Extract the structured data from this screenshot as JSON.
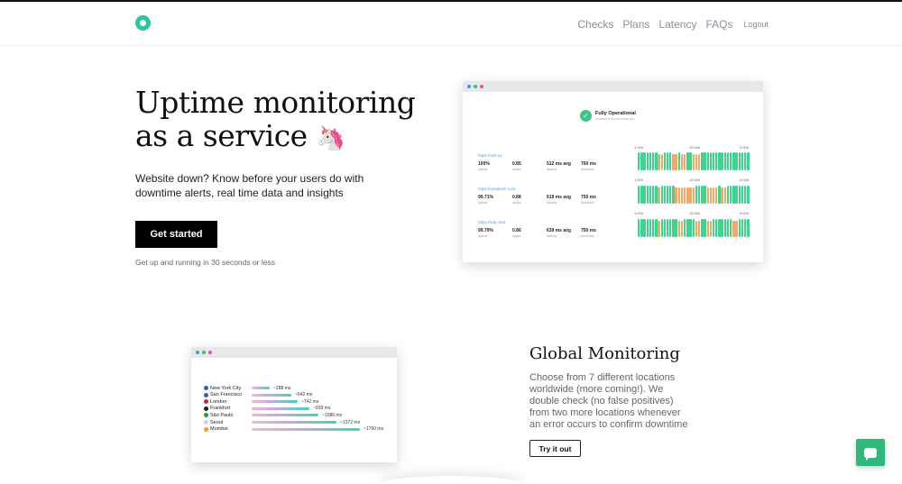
{
  "nav": {
    "links": [
      "Checks",
      "Plans",
      "Latency",
      "FAQs"
    ],
    "logout": "Logout"
  },
  "hero": {
    "title_line1": "Uptime monitoring",
    "title_line2": "as a service",
    "emoji": "🦄",
    "subtitle": "Website down? Know before your users do with downtime alerts, real time data and insights",
    "cta": "Get started",
    "note": "Get up and running in 30 seconds or less"
  },
  "dashboard": {
    "status_title": "Fully Operational",
    "status_sub": "Updated a few seconds ago",
    "ticks": [
      "1:00h",
      "13:00h",
      "0:00h"
    ],
    "labels": [
      "uptime",
      "apdex",
      "latency",
      "threshold"
    ],
    "checks": [
      {
        "url": "https://zeit.co",
        "uptime": "100%",
        "apdex": "0.85",
        "latency": "512 ms avg",
        "threshold": "750 ms"
      },
      {
        "url": "https://unsplash.com",
        "uptime": "99.71%",
        "apdex": "0.88",
        "latency": "619 ms avg",
        "threshold": "750 ms"
      },
      {
        "url": "https://wip.chat",
        "uptime": "99.79%",
        "apdex": "0.86",
        "latency": "639 ms avg",
        "threshold": "750 ms"
      }
    ],
    "colors": {
      "good": "#3ed68f",
      "slow": "#f3a863"
    }
  },
  "locations": [
    {
      "name": "New York City",
      "value": "~288 ms",
      "flag": "#3c5aa8"
    },
    {
      "name": "San Francisco",
      "value": "~642 ms",
      "flag": "#3c5aa8"
    },
    {
      "name": "London",
      "value": "~742 ms",
      "flag": "#c8283a"
    },
    {
      "name": "Frankfurt",
      "value": "~939 ms",
      "flag": "#222222"
    },
    {
      "name": "São Paulo",
      "value": "~1086 ms",
      "flag": "#2a9d3c"
    },
    {
      "name": "Seoul",
      "value": "~1372 ms",
      "flag": "#d0d0d0"
    },
    {
      "name": "Mumbai",
      "value": "~1760 ms",
      "flag": "#f09a3a"
    }
  ],
  "global": {
    "title": "Global Monitoring",
    "text": "Choose from 7 different locations worldwide (more coming!). We double check (no false positives) from two more locations whenever an error occurs to confirm downtime",
    "cta": "Try it out"
  },
  "chat": {
    "icon": "chat-icon"
  }
}
